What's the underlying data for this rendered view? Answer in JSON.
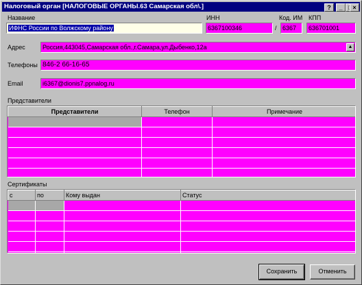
{
  "window": {
    "title": "Налоговый орган [НАЛОГОВЫЕ ОРГАНЫ.63   Самарская обл\\.]",
    "help_glyph": "?",
    "min_glyph": "_",
    "max_glyph": "□",
    "close_glyph": "×"
  },
  "form": {
    "name_label": "Название",
    "name_value": "ИФНС России по Волжскому району",
    "inn_label": "ИНН",
    "inn_value": "6367100346",
    "kod_label": "Код. ИМ",
    "kod_sep": "/",
    "kod_value": "6367",
    "kpp_label": "КПП",
    "kpp_value": "636701001",
    "address_label": "Адрес",
    "address_value": "Россия,443045,Самарская обл.,г.Самара,ул.Дыбенко,12а",
    "phones_label": "Телефоны",
    "phones_value": "846-2 66-16-65",
    "email_label": "Email",
    "email_value": "i6367@dionis7.ppnalog.ru"
  },
  "representatives": {
    "section_label": "Представители",
    "columns": [
      "Представители",
      "Телефон",
      "Примечание"
    ],
    "row_count": 6
  },
  "certificates": {
    "section_label": "Сертификаты",
    "columns": [
      "с",
      "по",
      "Кому выдан",
      "Статус"
    ],
    "row_count": 6
  },
  "buttons": {
    "save": "Сохранить",
    "cancel": "Отменить"
  },
  "colors": {
    "field_bg": "#ff00ff",
    "title_bg": "#000080",
    "window_bg": "#c0c0c0"
  }
}
